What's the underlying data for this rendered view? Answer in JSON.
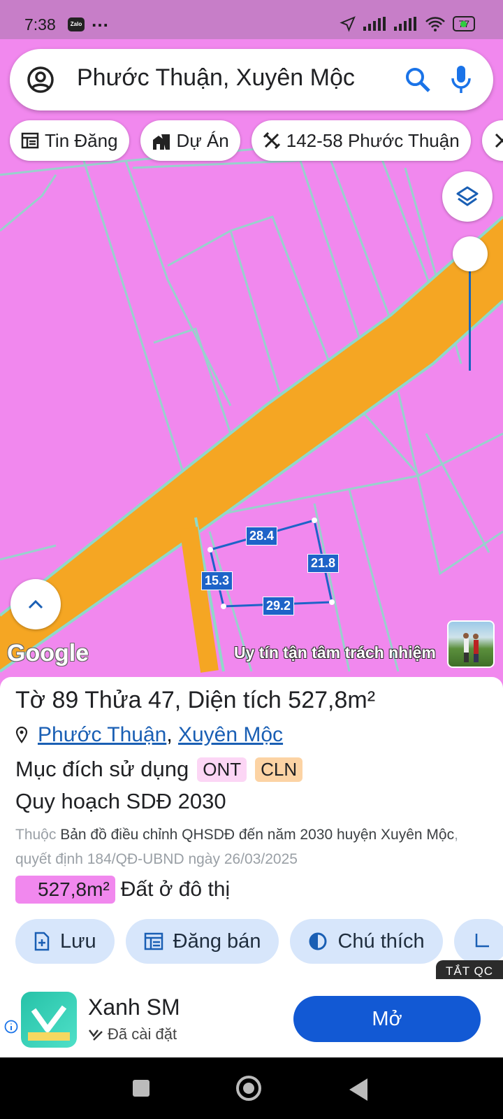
{
  "status_bar": {
    "time": "7:38",
    "notification_app": "Zalo",
    "more": "…",
    "battery": "77"
  },
  "search": {
    "query": "Phước Thuận, Xuyên Mộc",
    "account_icon": "account-circle-icon",
    "search_icon": "search-icon",
    "mic_icon": "mic-icon"
  },
  "chips": [
    {
      "label": "Tin Đăng",
      "icon": "listing-icon"
    },
    {
      "label": "Dự Án",
      "icon": "building-icon"
    },
    {
      "label": "142-58 Phước Thuận",
      "icon": "ruler-tools-icon"
    }
  ],
  "map": {
    "dimensions": {
      "top": "28.4",
      "right": "21.8",
      "left": "15.3",
      "bottom": "29.2"
    },
    "google": "Google",
    "tagline": "Uy tín tận tâm trách nhiệm",
    "colors": {
      "land": "#f188ee",
      "road": "#f5a623",
      "boundary": "#8fd9c9",
      "parcel": "#1e63c8"
    }
  },
  "parcel": {
    "title": "Tờ 89 Thửa 47, Diện tích 527,8m²",
    "commune": "Phước Thuận",
    "separator": ", ",
    "district": "Xuyên Mộc",
    "purpose_label": "Mục đích sử dụng",
    "purpose_codes": [
      "ONT",
      "CLN"
    ],
    "plan_title": "Quy hoạch SDĐ 2030",
    "plan_prefix": "Thuộc",
    "plan_name": "Bản đồ điều chỉnh QHSDĐ đến năm 2030 huyện Xuyên Mộc",
    "plan_decision": ", quyết định 184/QĐ-UBND ngày 26/03/2025",
    "area_value": "527,8m²",
    "area_label": "Đất ở đô thị"
  },
  "actions": [
    {
      "label": "Lưu",
      "icon": "add-file-icon"
    },
    {
      "label": "Đăng bán",
      "icon": "listing-icon"
    },
    {
      "label": "Chú thích",
      "icon": "contrast-icon"
    }
  ],
  "ad": {
    "close": "TẮT QC",
    "app_name": "Xanh SM",
    "status": "Đã cài đặt",
    "button": "Mở"
  }
}
